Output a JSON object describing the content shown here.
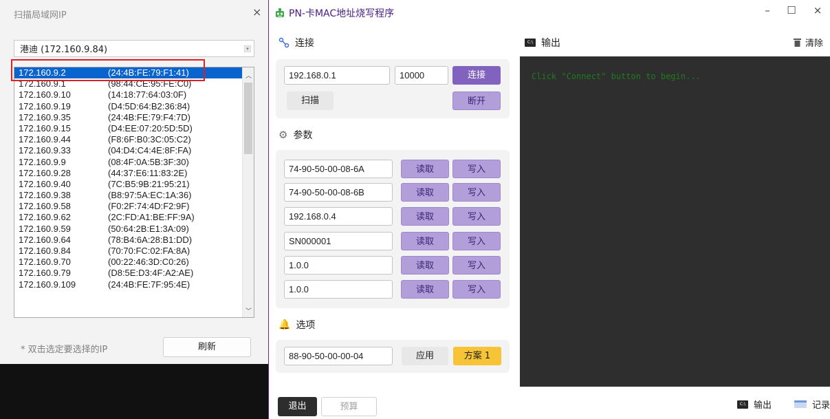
{
  "scan_dialog": {
    "title": "扫描局域网IP",
    "close_glyph": "×",
    "interface": "港迪 (172.160.9.84)",
    "entries": [
      {
        "ip": "172.160.9.2",
        "mac": "(24:4B:FE:79:F1:41)",
        "selected": true
      },
      {
        "ip": "172.160.9.1",
        "mac": "(98:44:CE:95:FE:C0)"
      },
      {
        "ip": "172.160.9.10",
        "mac": "(14:18:77:64:03:0F)"
      },
      {
        "ip": "172.160.9.19",
        "mac": "(D4:5D:64:B2:36:84)"
      },
      {
        "ip": "172.160.9.35",
        "mac": "(24:4B:FE:79:F4:7D)"
      },
      {
        "ip": "172.160.9.15",
        "mac": "(D4:EE:07:20:5D:5D)"
      },
      {
        "ip": "172.160.9.44",
        "mac": "(F8:6F:B0:3C:05:C2)"
      },
      {
        "ip": "172.160.9.33",
        "mac": "(04:D4:C4:4E:8F:FA)"
      },
      {
        "ip": "172.160.9.9",
        "mac": "(08:4F:0A:5B:3F:30)"
      },
      {
        "ip": "172.160.9.28",
        "mac": "(44:37:E6:11:83:2E)"
      },
      {
        "ip": "172.160.9.40",
        "mac": "(7C:B5:9B:21:95:21)"
      },
      {
        "ip": "172.160.9.38",
        "mac": "(B8:97:5A:EC:1A:36)"
      },
      {
        "ip": "172.160.9.58",
        "mac": "(F0:2F:74:4D:F2:9F)"
      },
      {
        "ip": "172.160.9.62",
        "mac": "(2C:FD:A1:BE:FF:9A)"
      },
      {
        "ip": "172.160.9.59",
        "mac": "(50:64:2B:E1:3A:09)"
      },
      {
        "ip": "172.160.9.64",
        "mac": "(78:B4:6A:28:B1:DD)"
      },
      {
        "ip": "172.160.9.84",
        "mac": "(70:70:FC:02:FA:8A)"
      },
      {
        "ip": "172.160.9.70",
        "mac": "(00:22:46:3D:C0:26)"
      },
      {
        "ip": "172.160.9.79",
        "mac": "(D8:5E:D3:4F:A2:AE)"
      },
      {
        "ip": "172.160.9.109",
        "mac": "(24:4B:FE:7F:95:4E)"
      }
    ],
    "hint": "* 双击选定要选择的IP",
    "refresh_label": "刷新"
  },
  "main_window": {
    "title": "PN-卡MAC地址烧写程序",
    "controls": {
      "minimize": "–",
      "maximize": "☐",
      "close": "×"
    },
    "connect": {
      "header": "连接",
      "ip_value": "192.168.0.1",
      "port_value": "10000",
      "connect_label": "连接",
      "scan_label": "扫描",
      "disconnect_label": "断开"
    },
    "params": {
      "header": "参数",
      "read_label": "读取",
      "write_label": "写入",
      "rows": [
        "74-90-50-00-08-6A",
        "74-90-50-00-08-6B",
        "192.168.0.4",
        "SN000001",
        "1.0.0",
        "1.0.0"
      ]
    },
    "options": {
      "header": "选项",
      "value": "88-90-50-00-00-04",
      "apply_label": "应用",
      "scheme_label": "方案 1"
    },
    "output": {
      "header": "输出",
      "clear_label": "清除",
      "message": "Click \"Connect\" button to begin..."
    },
    "footer": {
      "exit_label": "退出",
      "calc_label": "预算",
      "tab_output": "输出",
      "tab_log": "记录"
    }
  },
  "colors": {
    "accent_purple": "#8262bf",
    "lavender": "#b29ed9",
    "selection_blue": "#0a64cd",
    "scheme_yellow": "#f6c436",
    "console_bg": "#2e2e2e",
    "console_text": "#1f7a1f",
    "highlight_red": "#e02020"
  }
}
